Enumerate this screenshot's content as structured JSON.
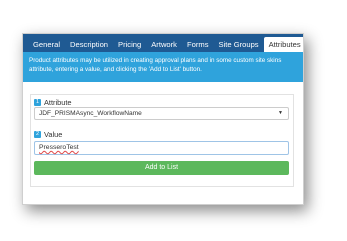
{
  "tabs": [
    {
      "label": "General",
      "active": false
    },
    {
      "label": "Description",
      "active": false
    },
    {
      "label": "Pricing",
      "active": false
    },
    {
      "label": "Artwork",
      "active": false
    },
    {
      "label": "Forms",
      "active": false
    },
    {
      "label": "Site Groups",
      "active": false
    },
    {
      "label": "Attributes",
      "active": true
    }
  ],
  "info": {
    "line1": "Product attributes may be utilized in creating approval plans and in some custom site skins",
    "line2": "attribute, entering a value, and clicking the 'Add to List' button."
  },
  "form": {
    "attribute": {
      "step": "1",
      "label": "Attribute",
      "selected": "JDF_PRISMAsync_WorkflowName"
    },
    "value": {
      "step": "2",
      "label": "Value",
      "input_value": "PresseroTest"
    },
    "add_button_label": "Add to List"
  },
  "colors": {
    "tab_bar": "#1f5a93",
    "info_bar": "#2fa3dc",
    "add_button": "#5cb85c"
  }
}
